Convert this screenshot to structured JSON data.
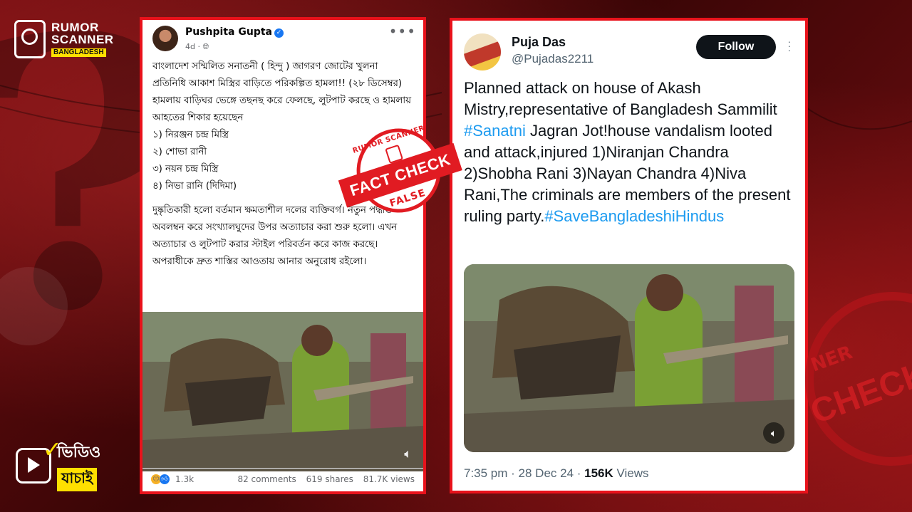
{
  "brand": {
    "line1": "RUMOR",
    "line2": "SCANNER",
    "line3": "BANGLADESH",
    "yachai_top": "ভিডিও",
    "yachai_bottom": "যাচাই"
  },
  "fb_post": {
    "author": "Pushpita Gupta",
    "age": "4d",
    "more": "•••",
    "paragraphs": [
      "বাংলাদেশ সম্মিলিত সনাতনী ( হিন্দু ) জাগরণ জোটের খুলনা প্রতিনিধি আকাশ মিস্ত্রির বাড়িতে পরিকল্পিত হামলা!! (২৮ ডিসেম্বর)",
      "হামলায় বাড়িঘর ভেঙ্গে তছনছ করে ফেলছে, লুটপাট করছে ও হামলায় আহতের শিকার হয়েছেন",
      "১) নিরঞ্জন চন্দ্র মিস্ত্রি",
      "২) শোভা রানী",
      "৩) নয়ন চন্দ্র মিস্ত্রি",
      "৪) নিভা রানি (দিদিমা)"
    ],
    "paragraph2": "দুষ্কৃতিকারী হলো বর্তমান ক্ষমতাশীল দলের ব্যক্তিবর্গ। নতুন পদ্ধতি অবলম্বন করে সংখ্যালঘুদের উপর অত্যাচার করা শুরু হলো। এখন অত্যাচার ও লুটপাট করার স্টাইল পরিবর্তন করে কাজ করছে। অপরাধীকে দ্রুত শাস্তির আওতায় আনার অনুরোধ রইলো।",
    "reactions": "1.3k",
    "comments": "82 comments",
    "shares": "619 shares",
    "views": "81.7K views"
  },
  "stamp": {
    "top": "RUMOR SCANNER",
    "main": "FACT CHECK",
    "verdict": "FALSE"
  },
  "tweet": {
    "name": "Puja Das",
    "handle": "@Pujadas2211",
    "follow": "Follow",
    "text_before": "Planned attack on house of Akash Mistry,representative of Bangladesh Sammilit ",
    "hashtag1": "#Sanatni",
    "text_middle": " Jagran Jot!house vandalism looted and attack,injured 1)Niranjan Chandra 2)Shobha Rani 3)Nayan Chandra 4)Niva Rani,The criminals are members of the present ruling party.",
    "hashtag2": "#SaveBangladeshiHindus",
    "time": "7:35 pm · 28 Dec 24 · ",
    "views_count": "156K",
    "views_label": " Views"
  },
  "bg_stamp": {
    "arc": "NER",
    "word": "CHECK"
  },
  "colors": {
    "frame_red": "#e8121b",
    "link_blue": "#1d9bf0",
    "fb_blue": "#1877f2",
    "brand_yellow": "#ffe000"
  }
}
